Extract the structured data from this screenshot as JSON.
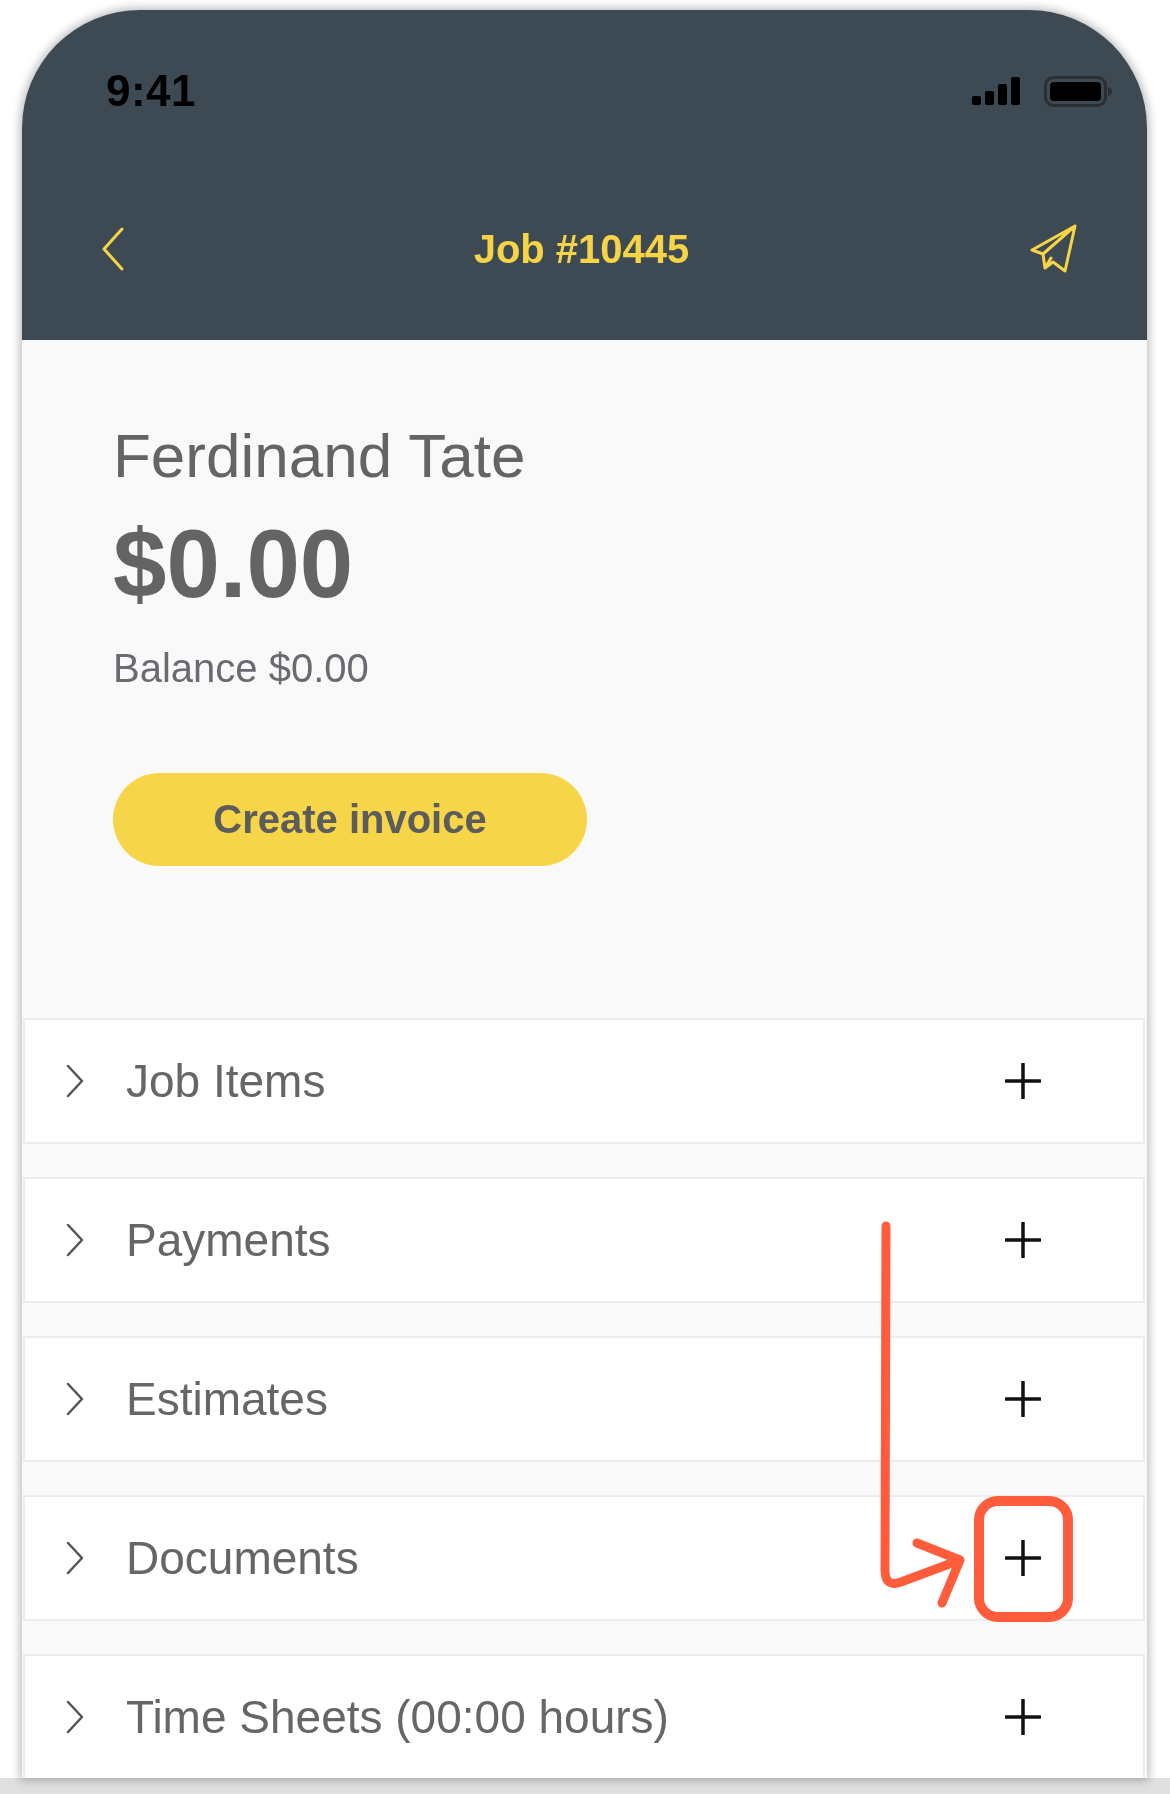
{
  "status_bar": {
    "time": "9:41"
  },
  "nav_bar": {
    "title": "Job #10445"
  },
  "summary": {
    "customer_name": "Ferdinand Tate",
    "total": "$0.00",
    "balance": "Balance $0.00"
  },
  "create_invoice_button": {
    "label": "Create invoice"
  },
  "sections": [
    {
      "label": "Job Items",
      "expanded": false,
      "highlighted": false
    },
    {
      "label": "Payments",
      "expanded": false,
      "highlighted": false
    },
    {
      "label": "Estimates",
      "expanded": false,
      "highlighted": false
    },
    {
      "label": "Documents",
      "expanded": false,
      "highlighted": true
    },
    {
      "label": "Time Sheets (00:00 hours)",
      "expanded": false,
      "highlighted": false
    }
  ]
}
